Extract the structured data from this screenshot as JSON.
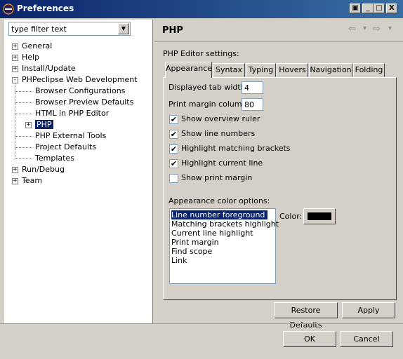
{
  "window": {
    "title": "Preferences",
    "controls": {
      "print": "▣",
      "help": "?",
      "minimize": "_",
      "maximize": "□",
      "close": "X"
    }
  },
  "filter": {
    "value": "type filter text"
  },
  "tree": [
    {
      "label": "General",
      "expander": "+"
    },
    {
      "label": "Help",
      "expander": "+"
    },
    {
      "label": "Install/Update",
      "expander": "+"
    },
    {
      "label": "PHPeclipse Web Development",
      "expander": "-"
    },
    {
      "label": "Browser Configurations"
    },
    {
      "label": "Browser Preview Defaults"
    },
    {
      "label": "HTML in PHP Editor"
    },
    {
      "label": "PHP",
      "expander": "+"
    },
    {
      "label": "PHP External Tools"
    },
    {
      "label": "Project Defaults"
    },
    {
      "label": "Templates"
    },
    {
      "label": "Run/Debug",
      "expander": "+"
    },
    {
      "label": "Team",
      "expander": "+"
    }
  ],
  "page": {
    "title": "PHP",
    "nav": {
      "back": "⇦",
      "back_menu": "▾",
      "forward": "⇨",
      "forward_menu": "▾"
    },
    "settings_label": "PHP Editor settings:",
    "tabs": [
      "Appearance",
      "Syntax",
      "Typing",
      "Hovers",
      "Navigation",
      "Folding"
    ],
    "tab_width_label": "Displayed tab width:",
    "tab_width_value": "4",
    "print_margin_label": "Print margin column:",
    "print_margin_value": "80",
    "checkboxes": [
      {
        "label": "Show overview ruler",
        "checked": true
      },
      {
        "label": "Show line numbers",
        "checked": true
      },
      {
        "label": "Highlight matching brackets",
        "checked": true
      },
      {
        "label": "Highlight current line",
        "checked": true
      },
      {
        "label": "Show print margin",
        "checked": false
      }
    ],
    "color_options_label": "Appearance color options:",
    "color_options": [
      "Line number foreground",
      "Matching brackets highlight",
      "Current line highlight",
      "Print margin",
      "Find scope",
      "Link"
    ],
    "color_label": "Color:",
    "swatch_color": "#000000",
    "restore_defaults": "Restore Defaults",
    "apply": "Apply"
  },
  "footer": {
    "ok": "OK",
    "cancel": "Cancel"
  }
}
